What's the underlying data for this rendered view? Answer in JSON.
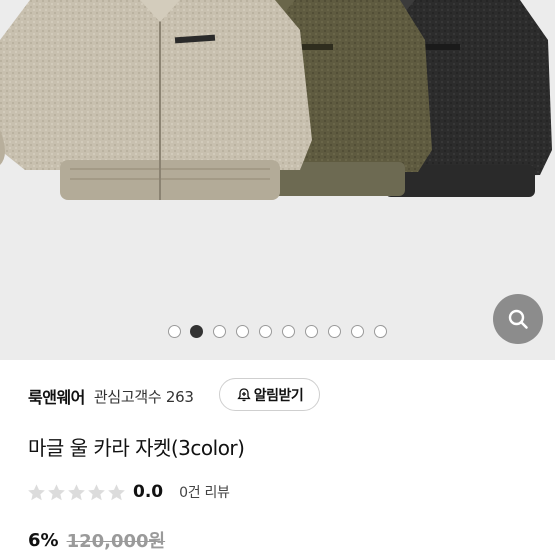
{
  "carousel": {
    "total": 10,
    "active_index": 1
  },
  "zoom": {
    "icon": "search-icon"
  },
  "brand": {
    "name": "룩앤웨어",
    "followers_label": "관심고객수 263"
  },
  "notify_button": {
    "label": "알림받기",
    "icon": "bell-plus-icon"
  },
  "product": {
    "title": "마글 울 카라 자켓(3color)"
  },
  "rating": {
    "value": "0.0",
    "stars_filled": 0,
    "stars_total": 5,
    "review_count_label": "0건 리뷰"
  },
  "price": {
    "discount": "6%",
    "original": "120,000원"
  },
  "colors": {
    "jacket_beige": "#c7bfae",
    "jacket_olive": "#5e5a3f",
    "jacket_black": "#2b2b2b",
    "zoom_bg": "#8c8c8c"
  }
}
